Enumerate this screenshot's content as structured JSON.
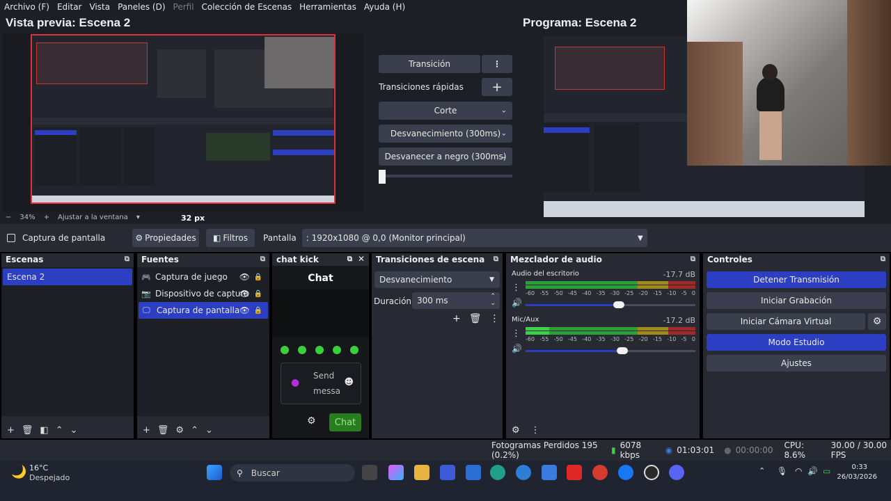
{
  "menu": {
    "items": [
      "Archivo (F)",
      "Editar",
      "Vista",
      "Paneles (D)",
      "Perfil",
      "Colección de Escenas",
      "Herramientas",
      "Ayuda (H)"
    ]
  },
  "preview": {
    "title": "Vista previa: Escena 2",
    "margin_label": "32 px",
    "zoom": "34%",
    "fit_label": "Ajustar a la ventana"
  },
  "program": {
    "title": "Programa: Escena 2"
  },
  "transition_panel": {
    "transition_button": "Transición",
    "quick_transitions": "Transiciones rápidas",
    "cut": "Corte",
    "fade": "Desvanecimiento (300ms)",
    "fade_black": "Desvanecer a negro (300ms)"
  },
  "source_toolbar": {
    "source_name": "Captura de pantalla",
    "properties": "Propiedades",
    "filters": "Filtros",
    "display_label": "Pantalla",
    "display_value": ": 1920x1080 @ 0,0 (Monitor principal)"
  },
  "scenes": {
    "title": "Escenas",
    "items": [
      "Escena 2"
    ]
  },
  "sources": {
    "title": "Fuentes",
    "items": [
      "Captura de juego",
      "Dispositivo de captura",
      "Captura de pantalla"
    ]
  },
  "chat": {
    "title": "chat kick",
    "heading": "Chat",
    "placeholder_line1": "Send",
    "placeholder_line2": "messa",
    "send_button": "Chat"
  },
  "scene_transitions": {
    "title": "Transiciones de escena",
    "selected": "Desvanecimiento",
    "duration_label": "Duración",
    "duration_value": "300 ms"
  },
  "mixer": {
    "title": "Mezclador de audio",
    "channels": [
      {
        "name": "Audio del escritorio",
        "db": "-17.7 dB",
        "level": 0.55
      },
      {
        "name": "Mic/Aux",
        "db": "-17.2 dB",
        "level": 0.57
      }
    ],
    "ticks": [
      "-60",
      "-55",
      "-50",
      "-45",
      "-40",
      "-35",
      "-30",
      "-25",
      "-20",
      "-15",
      "-10",
      "-5",
      "0"
    ]
  },
  "controls": {
    "title": "Controles",
    "buttons": [
      "Detener Transmisión",
      "Iniciar Grabación",
      "Iniciar Cámara Virtual",
      "Modo Estudio",
      "Ajustes"
    ]
  },
  "status": {
    "frames_dropped": "Fotogramas Perdidos 195 (0.2%)",
    "bitrate": "6078 kbps",
    "stream_time": "01:03:01",
    "rec_time": "00:00:00",
    "cpu": "CPU: 8.6%",
    "fps": "30.00 / 30.00 FPS"
  },
  "taskbar": {
    "weather_temp": "16°C",
    "weather_desc": "Despejado",
    "search": "Buscar",
    "time": "0:33",
    "date": "26/03/2026"
  },
  "colors": {
    "accent": "#2c3ec2",
    "dock_bg": "#272a33",
    "canvas_border": "#e0303a",
    "meter_green": "#2e9e3a",
    "meter_yellow": "#a08a1c",
    "meter_red": "#9e2a2a",
    "chat_green": "#2a7d1e"
  }
}
